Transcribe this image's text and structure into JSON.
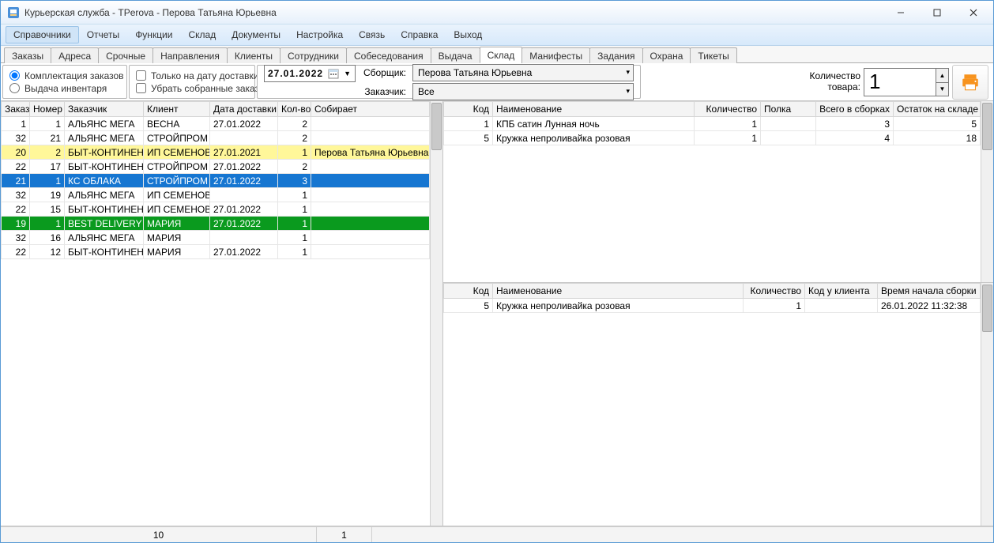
{
  "window": {
    "title": "Курьерская служба - TPerova - Перова Татьяна Юрьевна"
  },
  "menu": [
    "Справочники",
    "Отчеты",
    "Функции",
    "Склад",
    "Документы",
    "Настройка",
    "Связь",
    "Справка",
    "Выход"
  ],
  "menu_active_index": 0,
  "tabs": [
    "Заказы",
    "Адреса",
    "Срочные",
    "Направления",
    "Клиенты",
    "Сотрудники",
    "Собеседования",
    "Выдача",
    "Склад",
    "Манифесты",
    "Задания",
    "Охрана",
    "Тикеты"
  ],
  "tabs_active_index": 8,
  "mode": {
    "opt1": "Комплектация заказов",
    "opt2": "Выдача инвентаря",
    "selected": 0
  },
  "checks": {
    "only_date": "Только на дату доставки:",
    "remove_collected": "Убрать собранные заказы"
  },
  "date_field": "27.01.2022",
  "dropdowns": {
    "picker_label": "Сборщик:",
    "picker_value": "Перова Татьяна Юрьевна",
    "customer_label": "Заказчик:",
    "customer_value": "Все"
  },
  "qty": {
    "label1": "Количество",
    "label2": "товара:",
    "value": "1"
  },
  "left_grid": {
    "headers": [
      "Заказ",
      "Номер",
      "Заказчик",
      "Клиент",
      "Дата доставки",
      "Кол-во",
      "Собирает"
    ],
    "rows": [
      {
        "c": [
          "1",
          "1",
          "АЛЬЯНС МЕГА",
          "ВЕСНА",
          "27.01.2022",
          "2",
          ""
        ],
        "cls": ""
      },
      {
        "c": [
          "32",
          "21",
          "АЛЬЯНС МЕГА",
          "СТРОЙПРОМ",
          "",
          "2",
          ""
        ],
        "cls": ""
      },
      {
        "c": [
          "20",
          "2",
          "БЫТ-КОНТИНЕНТ",
          "ИП СЕМЕНОВ",
          "27.01.2021",
          "1",
          "Перова Татьяна Юрьевна"
        ],
        "cls": "row-yellow"
      },
      {
        "c": [
          "22",
          "17",
          "БЫТ-КОНТИНЕНТ",
          "СТРОЙПРОМ",
          "27.01.2022",
          "2",
          ""
        ],
        "cls": ""
      },
      {
        "c": [
          "21",
          "1",
          "КС ОБЛАКА",
          "СТРОЙПРОМ",
          "27.01.2022",
          "3",
          ""
        ],
        "cls": "row-blue"
      },
      {
        "c": [
          "32",
          "19",
          "АЛЬЯНС МЕГА",
          "ИП СЕМЕНОВ",
          "",
          "1",
          ""
        ],
        "cls": ""
      },
      {
        "c": [
          "22",
          "15",
          "БЫТ-КОНТИНЕНТ",
          "ИП СЕМЕНОВ",
          "27.01.2022",
          "1",
          ""
        ],
        "cls": ""
      },
      {
        "c": [
          "19",
          "1",
          "BEST DELIVERY",
          "МАРИЯ",
          "27.01.2022",
          "1",
          ""
        ],
        "cls": "row-green"
      },
      {
        "c": [
          "32",
          "16",
          "АЛЬЯНС МЕГА",
          "МАРИЯ",
          "",
          "1",
          ""
        ],
        "cls": ""
      },
      {
        "c": [
          "22",
          "12",
          "БЫТ-КОНТИНЕНТ",
          "МАРИЯ",
          "27.01.2022",
          "1",
          ""
        ],
        "cls": ""
      }
    ]
  },
  "right_top_grid": {
    "headers": [
      "Код",
      "Наименование",
      "Количество",
      "Полка",
      "Всего в сборках",
      "Остаток на складе"
    ],
    "rows": [
      {
        "c": [
          "1",
          "КПБ сатин Лунная ночь",
          "1",
          "",
          "3",
          "5"
        ]
      },
      {
        "c": [
          "5",
          "Кружка непроливайка розовая",
          "1",
          "",
          "4",
          "18"
        ]
      }
    ]
  },
  "right_bottom_grid": {
    "headers": [
      "Код",
      "Наименование",
      "Количество",
      "Код у клиента",
      "Время начала сборки"
    ],
    "rows": [
      {
        "c": [
          "5",
          "Кружка непроливайка розовая",
          "1",
          "",
          "26.01.2022 11:32:38"
        ]
      }
    ]
  },
  "status": {
    "cell1": "10",
    "cell2": "1"
  }
}
